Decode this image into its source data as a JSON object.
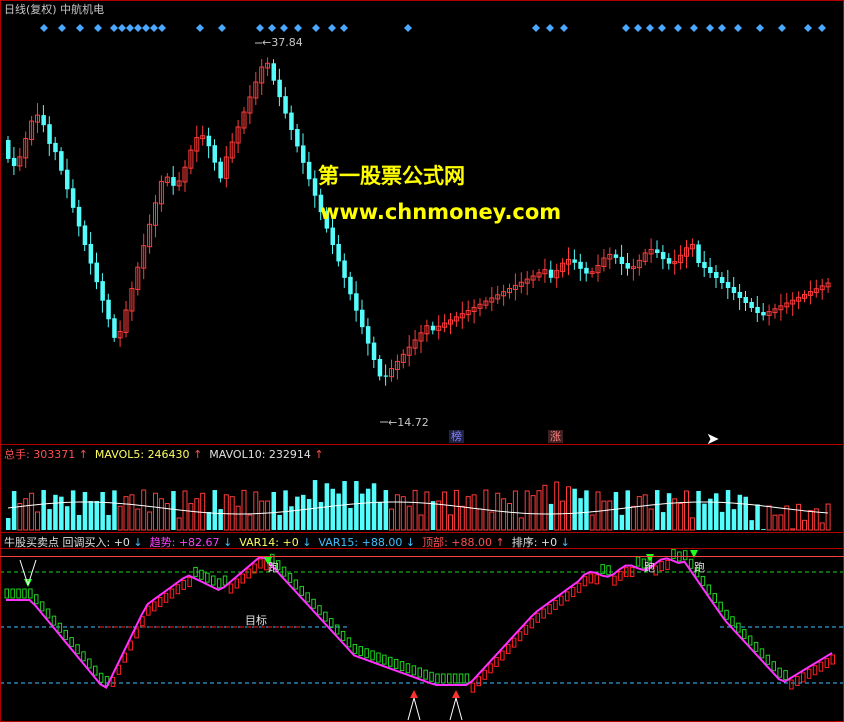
{
  "window": {
    "title": "日线(复权)  中航机电"
  },
  "watermark": {
    "line1": "第一股票公式网",
    "line2": "www.chnmoney.com",
    "color": "#ffff00"
  },
  "price_panel": {
    "high_label": "37.84",
    "low_label": "14.72",
    "tags": [
      "榜",
      "涨"
    ],
    "colors": {
      "up": "#ff3b3b",
      "down": "#54fcfc",
      "diamond": "#4aa8ff",
      "border": "#b00000"
    }
  },
  "volume_panel": {
    "title": "总手",
    "value": "303371",
    "ma5_label": "MAVOL5",
    "ma5_value": "246430",
    "ma10_label": "MAVOL10",
    "ma10_value": "232914",
    "arrow_up": "↑"
  },
  "indicator_panel": {
    "name": "牛股买卖点",
    "pullback_label": "回调买入",
    "pullback_value": "+0",
    "trend_label": "趋势",
    "trend_value": "+82.67",
    "var14_label": "VAR14",
    "var14_value": "+0",
    "var15_label": "VAR15",
    "var15_value": "+88.00",
    "top_label": "顶部",
    "top_value": "+88.00",
    "rank_label": "排序",
    "rank_value": "+0",
    "arrow_down": "↓",
    "arrow_up": "↑",
    "run_label": "跑",
    "target_label": "目标",
    "colors": {
      "trend": "#ff30ff",
      "red": "#ff2020",
      "green": "#20d020",
      "cyan": "#40c0ff",
      "yellow": "#ffff40"
    }
  }
}
